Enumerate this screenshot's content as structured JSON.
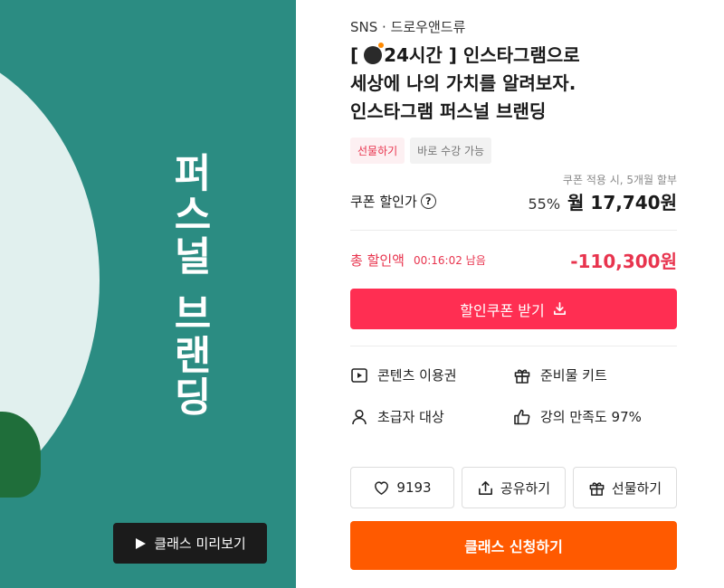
{
  "hero": {
    "vertical_text": "퍼스널 브랜딩",
    "preview_button_label": "클래스 미리보기"
  },
  "breadcrumb": "SNS · 드로우앤드류",
  "title": {
    "prefix": "[",
    "highlight": "24시간 ]",
    "line1_rest": " 인스타그램으로",
    "line2": "세상에 나의 가치를 알려보자.",
    "line3": "인스타그램 퍼스널 브랜딩"
  },
  "tags": [
    "선물하기",
    "바로 수강 가능"
  ],
  "pricing": {
    "installment_note": "쿠폰 적용 시, 5개월 할부",
    "coupon_label": "쿠폰 할인가",
    "discount_percent": "55%",
    "monthly_price": "월 17,740원"
  },
  "discount": {
    "label": "총 할인액",
    "timer": "00:16:02 남음",
    "amount": "-110,300원"
  },
  "coupon_button_label": "할인쿠폰 받기",
  "features": [
    {
      "icon": "play-square-icon",
      "label": "콘텐츠 이용권"
    },
    {
      "icon": "gift-icon",
      "label": "준비물 키트"
    },
    {
      "icon": "person-icon",
      "label": "초급자 대상"
    },
    {
      "icon": "thumbs-up-icon",
      "label": "강의 만족도 97%"
    }
  ],
  "actions": {
    "like_count": "9193",
    "share_label": "공유하기",
    "gift_label": "선물하기"
  },
  "apply_button_label": "클래스 신청하기",
  "colors": {
    "hero_green": "#2b8c82",
    "accent_red": "#ff2e52",
    "discount_red": "#e8344e",
    "apply_orange": "#ff5a00"
  }
}
